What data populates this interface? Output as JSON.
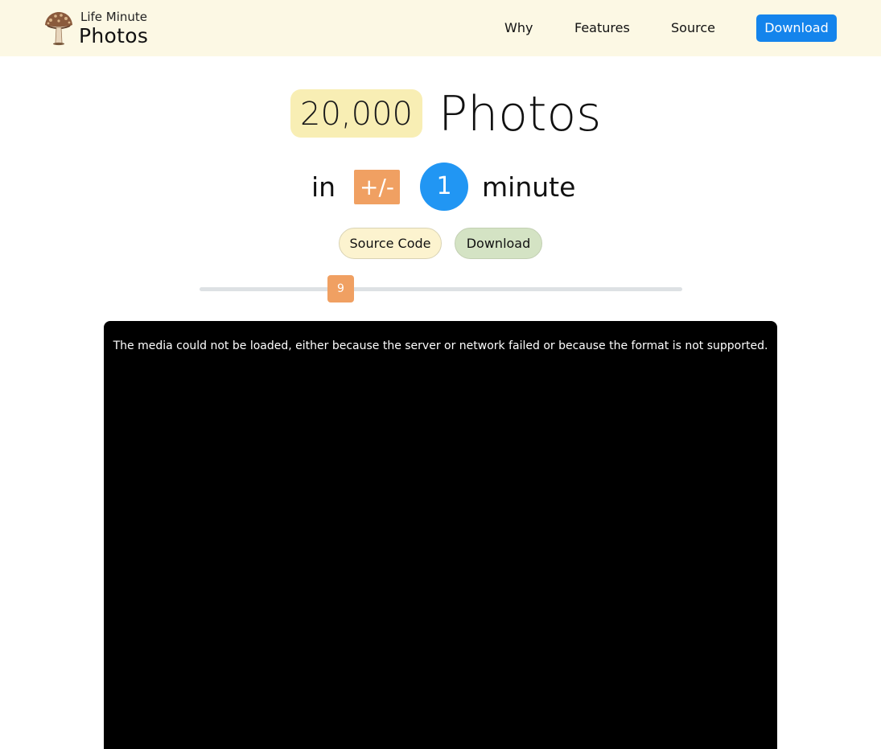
{
  "header": {
    "brand_small": "Life Minute",
    "brand_big": "Photos",
    "nav": {
      "why": "Why",
      "features": "Features",
      "source": "Source",
      "download": "Download"
    },
    "colors": {
      "bar_bg": "#fcf8e4",
      "download_bg": "#1484ec"
    }
  },
  "hero": {
    "photo_count": "20,000",
    "photos_label": "Photos",
    "in_label": "in",
    "plus_minus": "+/-",
    "minute_value": "1",
    "minute_label": "minute",
    "source_code_button": "Source Code",
    "download_button": "Download"
  },
  "slider": {
    "value": "9",
    "fraction": 0.28
  },
  "video": {
    "error_message": "The media could not be loaded, either because the server or network failed or because the format is not supported."
  },
  "icons": {
    "logo": "mushroom-logo-icon"
  }
}
